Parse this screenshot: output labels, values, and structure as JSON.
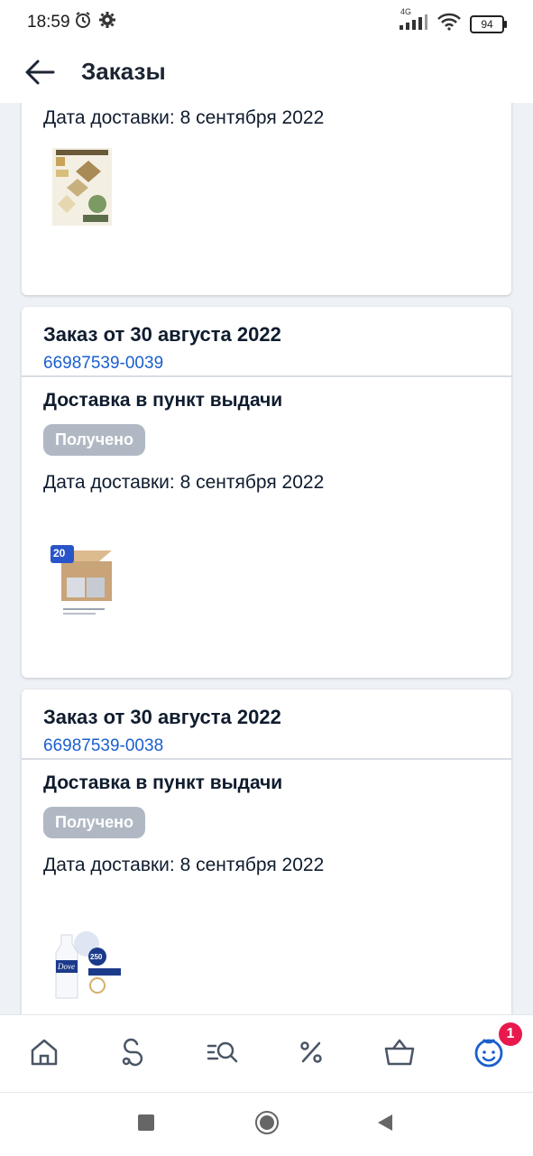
{
  "status_bar": {
    "time": "18:59",
    "network": "4G",
    "battery": "94"
  },
  "appbar": {
    "title": "Заказы"
  },
  "orders": [
    {
      "delivery_date": "Дата доставки: 8 сентября 2022"
    },
    {
      "title": "Заказ от 30 августа 2022",
      "number": "66987539-0039",
      "delivery_type": "Доставка в пункт выдачи",
      "status": "Получено",
      "delivery_date": "Дата доставки: 8 сентября 2022",
      "thumb_badge": "20"
    },
    {
      "title": "Заказ от 30 августа 2022",
      "number": "66987539-0038",
      "delivery_type": "Доставка в пункт выдачи",
      "status": "Получено",
      "delivery_date": "Дата доставки: 8 сентября 2022",
      "thumb_brand": "Dove",
      "thumb_volume": "250"
    }
  ],
  "bottom_nav": {
    "items": [
      "home-icon",
      "catalog-icon",
      "search-icon",
      "discount-icon",
      "cart-icon",
      "profile-icon"
    ],
    "profile_badge": "1",
    "accent": "#1a5fcc"
  },
  "colors": {
    "link": "#1a5fcc",
    "badge_bg": "#b0b8c3",
    "notif": "#e8194d"
  }
}
